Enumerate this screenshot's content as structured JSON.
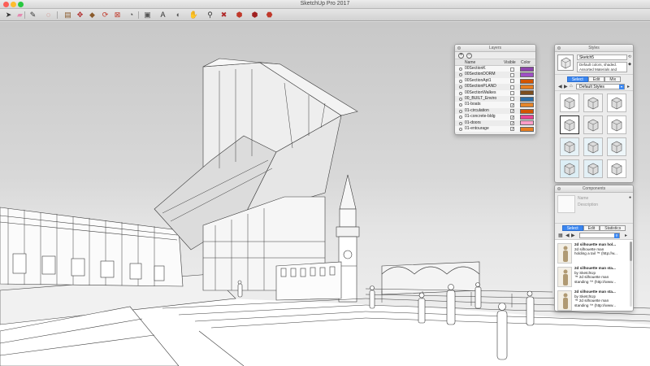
{
  "window": {
    "title": "SketchUp Pro 2017"
  },
  "toolbar": {
    "tools": [
      {
        "icon": "select-arrow-icon",
        "glyph": "➤",
        "color": "#333333"
      },
      {
        "icon": "eraser-icon",
        "glyph": "▰",
        "color": "#e58ab0"
      },
      {
        "icon": "pencil-line-icon",
        "glyph": "✎",
        "color": "#333333"
      },
      {
        "icon": "shape-circle-icon",
        "glyph": "◌",
        "color": "#c0392b"
      },
      {
        "icon": "push-pull-icon",
        "glyph": "▤",
        "color": "#8a5a2b"
      },
      {
        "icon": "move-icon",
        "glyph": "✥",
        "color": "#b02a2a"
      },
      {
        "icon": "paint-bucket-icon",
        "glyph": "◆",
        "color": "#8a5a2b"
      },
      {
        "icon": "rotate-icon",
        "glyph": "⟳",
        "color": "#c0392b"
      },
      {
        "icon": "scale-icon",
        "glyph": "⊠",
        "color": "#c0392b"
      },
      {
        "icon": "tape-measure-icon",
        "glyph": "◔",
        "color": "#444444"
      },
      {
        "icon": "text-label-icon",
        "glyph": "▣",
        "color": "#555555"
      },
      {
        "icon": "dimension-icon",
        "glyph": "A",
        "color": "#333333"
      },
      {
        "icon": "orbit-icon",
        "glyph": "◐",
        "color": "#555555"
      },
      {
        "icon": "pan-icon",
        "glyph": "✋",
        "color": "#6b4a2b"
      },
      {
        "icon": "zoom-icon",
        "glyph": "⚲",
        "color": "#333333"
      },
      {
        "icon": "zoom-extents-icon",
        "glyph": "✖",
        "color": "#b02a2a"
      },
      {
        "icon": "warehouse-icon",
        "glyph": "⬢",
        "color": "#c0392b"
      },
      {
        "icon": "extension-warehouse-icon",
        "glyph": "⬢",
        "color": "#a02020"
      },
      {
        "icon": "layout-send-icon",
        "glyph": "⬣",
        "color": "#c0392b"
      }
    ]
  },
  "layers_panel": {
    "title": "Layers",
    "col_name": "Name",
    "col_visible": "Visible",
    "col_color": "Color",
    "layers": [
      {
        "name": "00SectionK",
        "visible": false,
        "color": "#8e44ad"
      },
      {
        "name": "00SectionDORM",
        "visible": false,
        "color": "#a04fc6"
      },
      {
        "name": "00SectionApt1",
        "visible": false,
        "color": "#d35400"
      },
      {
        "name": "00SectionPLAND",
        "visible": false,
        "color": "#e67e22"
      },
      {
        "name": "00SectionWalkes",
        "visible": false,
        "color": "#7d4e1f"
      },
      {
        "name": "00_BUILT_Enviro",
        "visible": false,
        "color": "#2c6ea6"
      },
      {
        "name": "01-boats",
        "visible": true,
        "color": "#e6862a"
      },
      {
        "name": "01-circulation",
        "visible": true,
        "color": "#d35400"
      },
      {
        "name": "01-concrete-bldg",
        "visible": true,
        "color": "#e84393"
      },
      {
        "name": "01-doors",
        "visible": true,
        "color": "#ff9ec8"
      },
      {
        "name": "01-entourage",
        "visible": true,
        "color": "#e67e22"
      }
    ]
  },
  "styles_panel": {
    "title": "Styles",
    "style_name": "Sketch5",
    "style_description": "Default colors, shaded. Assorted Materials and",
    "tabs": [
      "Select",
      "Edit",
      "Mix"
    ],
    "active_tab": "Select",
    "collection": "Default Styles",
    "accent": "#3a86f0"
  },
  "components_panel": {
    "title": "Components",
    "preview_name": "Name",
    "preview_desc": "Description",
    "tabs": [
      "Select",
      "Edit",
      "Statistics"
    ],
    "active_tab": "Select",
    "items": [
      {
        "title": "2d silhouette man hol...",
        "line2": "2d silhouette man",
        "line3": "holding a tail ™ (http://w..."
      },
      {
        "title": "2d silhouette man sta...",
        "line2": "by SketchUp",
        "line3": "™ 2d silhouette man",
        "line4": "standing ™ (http://www..."
      },
      {
        "title": "2d silhouette man sta...",
        "line2": "by SketchUp",
        "line3": "™ 2d silhouette man",
        "line4": "standing ™ (http://www..."
      }
    ]
  }
}
